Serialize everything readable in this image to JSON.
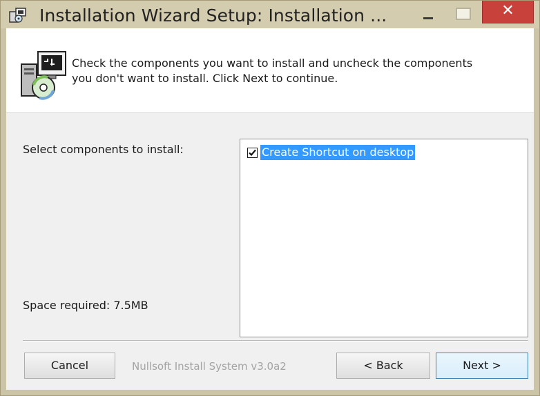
{
  "window": {
    "title": "Installation Wizard Setup: Installation ...",
    "close_glyph": "✕"
  },
  "header": {
    "description_line1": "Check the components you want to install and uncheck the components",
    "description_line2": "you don't want to install. Click Next to continue.",
    "icon": "installer-computer-disc-icon"
  },
  "components": {
    "select_label": "Select components to install:",
    "space_required": "Space required: 7.5MB",
    "items": [
      {
        "label": "Create Shortcut on desktop",
        "checked": true,
        "selected": true
      }
    ]
  },
  "footer": {
    "branding": "Nullsoft Install System v3.0a2",
    "cancel_label": "Cancel",
    "back_label": "< Back",
    "next_label": "Next >"
  },
  "colors": {
    "titlebar": "#d3ccaf",
    "close_button": "#c8413a",
    "selection": "#3399ff"
  }
}
